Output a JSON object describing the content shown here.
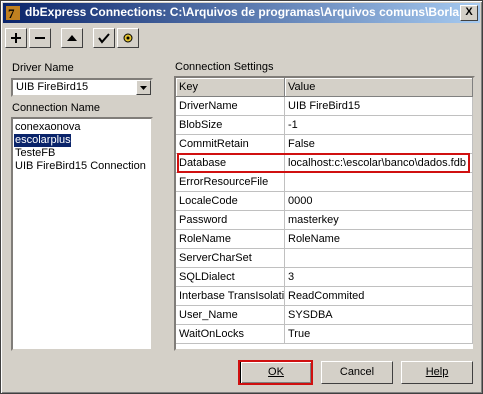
{
  "window": {
    "title": "dbExpress Connections: C:\\Arquivos de programas\\Arquivos comuns\\Borla...",
    "close_label": "X"
  },
  "toolbar": {
    "buttons": [
      "add-connection",
      "delete-connection",
      "up",
      "test-connection",
      "settings"
    ]
  },
  "driver": {
    "label": "Driver Name",
    "value": "UIB FireBird15"
  },
  "connections": {
    "label": "Connection Name",
    "items": [
      {
        "name": "conexaonova",
        "selected": false
      },
      {
        "name": "escolarplus",
        "selected": true
      },
      {
        "name": "TesteFB",
        "selected": false
      },
      {
        "name": "UIB FireBird15 Connection",
        "selected": false
      }
    ]
  },
  "settings": {
    "label": "Connection Settings",
    "header": {
      "key": "Key",
      "value": "Value"
    },
    "rows": [
      {
        "key": "DriverName",
        "value": "UIB FireBird15"
      },
      {
        "key": "BlobSize",
        "value": "-1"
      },
      {
        "key": "CommitRetain",
        "value": "False"
      },
      {
        "key": "Database",
        "value": "localhost:c:\\escolar\\banco\\dados.fdb"
      },
      {
        "key": "ErrorResourceFile",
        "value": ""
      },
      {
        "key": "LocaleCode",
        "value": "0000"
      },
      {
        "key": "Password",
        "value": "masterkey"
      },
      {
        "key": "RoleName",
        "value": "RoleName"
      },
      {
        "key": "ServerCharSet",
        "value": ""
      },
      {
        "key": "SQLDialect",
        "value": "3"
      },
      {
        "key": "Interbase TransIsolation",
        "value": "ReadCommited"
      },
      {
        "key": "User_Name",
        "value": "SYSDBA"
      },
      {
        "key": "WaitOnLocks",
        "value": "True"
      }
    ]
  },
  "buttons": {
    "ok": "OK",
    "cancel": "Cancel",
    "help": "Help"
  },
  "colors": {
    "highlight": "#d01010",
    "selection": "#0a246a"
  }
}
